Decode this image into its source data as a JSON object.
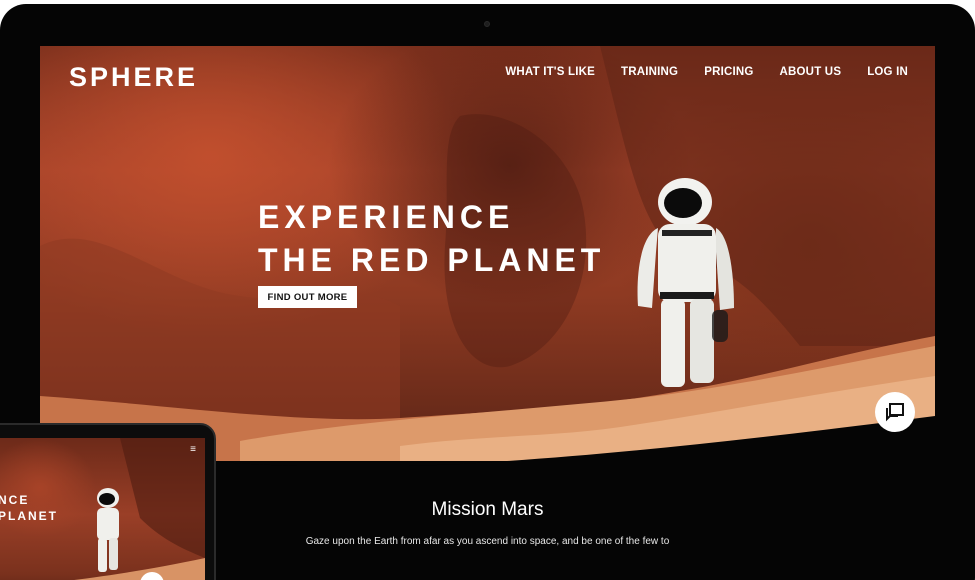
{
  "brand": {
    "logo": "SPHERE"
  },
  "nav": {
    "items": [
      "WHAT IT'S LIKE",
      "TRAINING",
      "PRICING",
      "ABOUT US",
      "LOG IN"
    ]
  },
  "hero": {
    "headline_line1": "EXPERIENCE",
    "headline_line2": "THE RED PLANET",
    "cta_label": "FIND OUT MORE",
    "chat_icon": "chat-icon"
  },
  "mission": {
    "title": "Mission Mars",
    "text": "Gaze upon the Earth from afar as you ascend into space, and be one of the few to"
  },
  "tablet": {
    "headline_line1": "NCE",
    "headline_line2": "PLANET",
    "menu_icon": "hamburger-menu-icon"
  },
  "colors": {
    "background": "#050505",
    "hero_red": "#a5432a",
    "sand": "#d99467",
    "text": "#ffffff"
  }
}
